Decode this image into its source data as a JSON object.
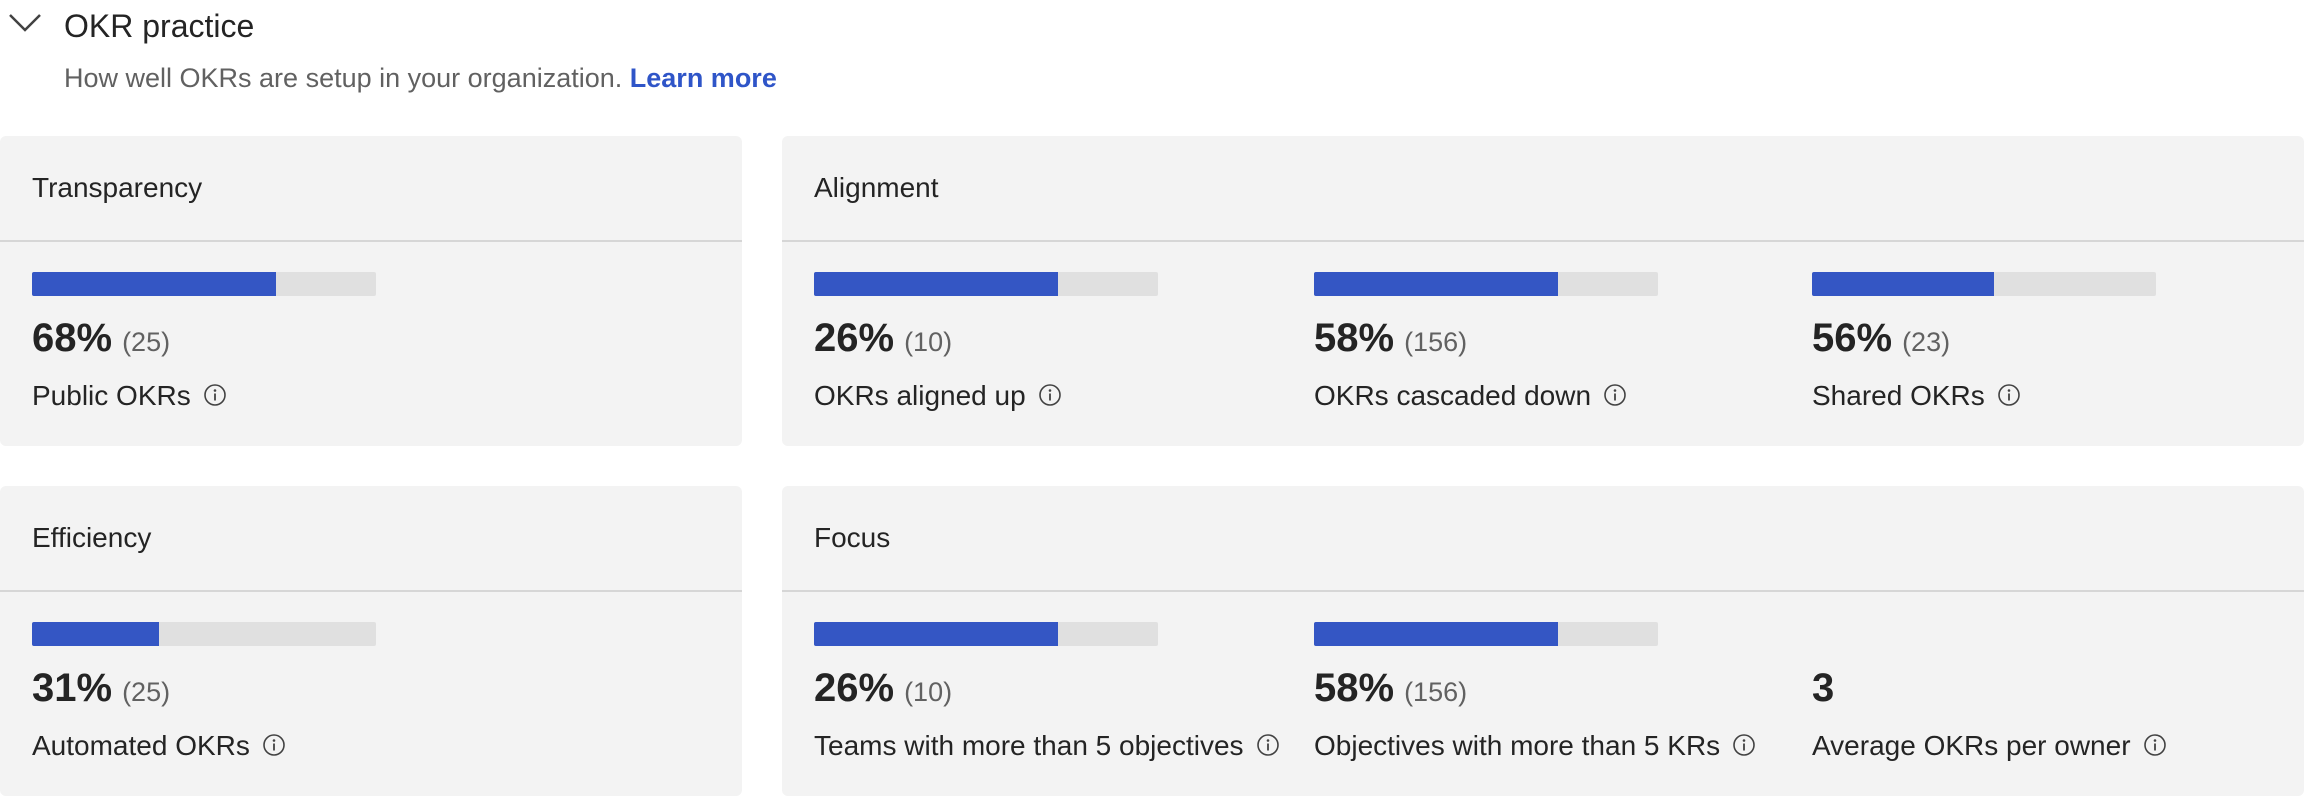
{
  "section": {
    "title": "OKR practice",
    "description": "How well OKRs are setup in your organization.",
    "learn_more": "Learn more",
    "collapse_icon": "chevron-down-icon"
  },
  "colors": {
    "bar_fill": "#3456c4",
    "bar_track": "#e0e0e0",
    "card_background": "#f3f3f3",
    "link": "#2f55c8"
  },
  "cards": {
    "transparency": {
      "title": "Transparency",
      "metrics": [
        {
          "value": "68%",
          "count": "(25)",
          "label": "Public OKRs",
          "progress": 0.71
        }
      ]
    },
    "alignment": {
      "title": "Alignment",
      "metrics": [
        {
          "value": "26%",
          "count": "(10)",
          "label": "OKRs aligned up",
          "progress": 0.71
        },
        {
          "value": "58%",
          "count": "(156)",
          "label": "OKRs cascaded down",
          "progress": 0.71
        },
        {
          "value": "56%",
          "count": "(23)",
          "label": "Shared OKRs",
          "progress": 0.53
        }
      ]
    },
    "efficiency": {
      "title": "Efficiency",
      "metrics": [
        {
          "value": "31%",
          "count": "(25)",
          "label": "Automated OKRs",
          "progress": 0.37
        }
      ]
    },
    "focus": {
      "title": "Focus",
      "metrics": [
        {
          "value": "26%",
          "count": "(10)",
          "label": "Teams with more than 5 objectives",
          "progress": 0.71
        },
        {
          "value": "58%",
          "count": "(156)",
          "label": "Objectives with more than 5 KRs",
          "progress": 0.71
        },
        {
          "value": "3",
          "count": "",
          "label": "Average OKRs per owner"
        }
      ]
    }
  }
}
